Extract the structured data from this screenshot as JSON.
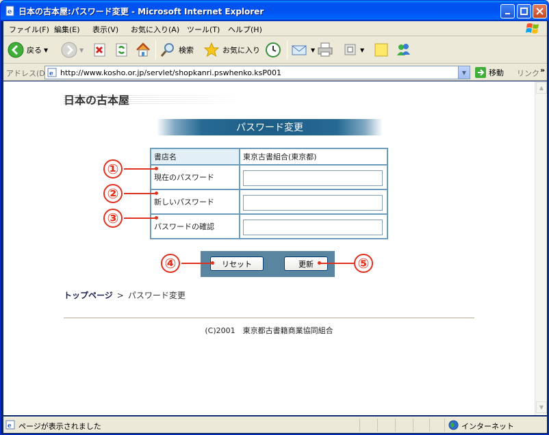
{
  "window": {
    "title": "日本の古本屋:パスワード変更 - Microsoft Internet Explorer"
  },
  "menubar": {
    "items": [
      "ファイル(F)",
      "編集(E)",
      "表示(V)",
      "お気に入り(A)",
      "ツール(T)",
      "ヘルプ(H)"
    ]
  },
  "toolbar": {
    "back_label": "戻る",
    "search_label": "検索",
    "favorites_label": "お気に入り"
  },
  "addressbar": {
    "label": "アドレス(D)",
    "url": "http://www.kosho.or.jp/servlet/shopkanri.pswhenko.ksP001",
    "go_label": "移動",
    "links_label": "リンク"
  },
  "page": {
    "logo_text": "日本の古本屋",
    "banner_title": "パスワード変更",
    "form": {
      "shop_name_label": "書店名",
      "shop_name_value": "東京古書組合(東京都)",
      "current_password_label": "現在のパスワード",
      "new_password_label": "新しいパスワード",
      "confirm_password_label": "パスワードの確認"
    },
    "buttons": {
      "reset_label": "リセット",
      "update_label": "更新"
    },
    "callouts": [
      "①",
      "②",
      "③",
      "④",
      "⑤"
    ],
    "breadcrumb": {
      "top_link": "トップページ",
      "separator": ">",
      "current": "パスワード変更"
    },
    "footer": "(C)2001　東京都古書籍商業協同組合"
  },
  "statusbar": {
    "text": "ページが表示されました",
    "zone": "インターネット"
  },
  "colors": {
    "titlebar": "#0053EE",
    "banner": "#1D5D86",
    "table_border": "#6B9BBB",
    "callout": "#E0301E",
    "button_panel": "#5A85A0"
  }
}
